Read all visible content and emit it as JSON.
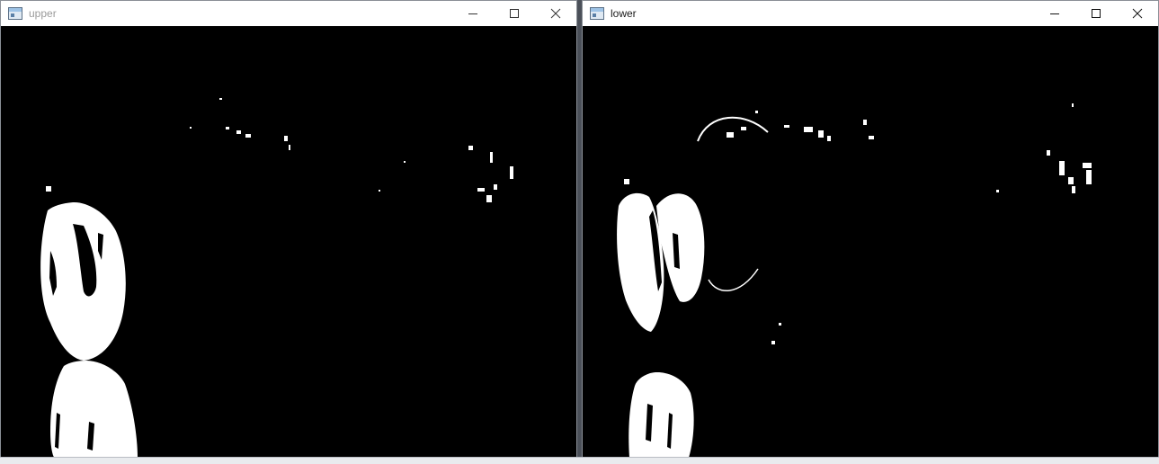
{
  "windows": [
    {
      "id": "upper",
      "title": "upper",
      "buttons": [
        "minimize",
        "maximize",
        "close"
      ],
      "icon": "app-window-icon",
      "content": "binary-threshold-image-black-background"
    },
    {
      "id": "lower",
      "title": "lower",
      "buttons": [
        "minimize",
        "maximize",
        "close"
      ],
      "icon": "app-window-icon",
      "content": "binary-threshold-image-black-background"
    }
  ],
  "colors": {
    "titlebar": "#ffffff",
    "canvas": "#000000",
    "blob": "#ffffff",
    "inactive_title": "#9a9a9a",
    "active_title": "#1a1a1a"
  }
}
